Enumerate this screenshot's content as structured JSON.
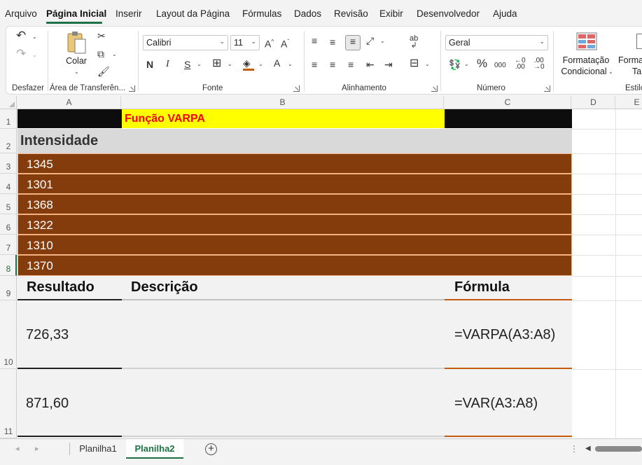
{
  "menu": {
    "items": [
      "Arquivo",
      "Página Inicial",
      "Inserir",
      "Layout da Página",
      "Fórmulas",
      "Dados",
      "Revisão",
      "Exibir",
      "Desenvolvedor",
      "Ajuda"
    ],
    "active": "Página Inicial"
  },
  "ribbon": {
    "groups": {
      "undo": "Desfazer",
      "clipboard": "Área de Transferên...",
      "font": "Fonte",
      "alignment": "Alinhamento",
      "number": "Número",
      "styles": "Estilo"
    },
    "paste_label": "Colar",
    "font_name": "Calibri",
    "font_size": "11",
    "number_format": "Geral",
    "bold": "N",
    "italic": "I",
    "underline": "S",
    "cond_format_line1": "Formatação",
    "cond_format_line2": "Condicional",
    "format_table_line1": "Forma",
    "format_table_line2": "Tab"
  },
  "columns": [
    "A",
    "B",
    "C",
    "D",
    "E"
  ],
  "rows": [
    "1",
    "2",
    "3",
    "4",
    "5",
    "6",
    "7",
    "8",
    "9",
    "10",
    "11"
  ],
  "sheet": {
    "title": "Função VARPA",
    "header": "Intensidade",
    "values": [
      "1345",
      "1301",
      "1368",
      "1322",
      "1310",
      "1370"
    ],
    "result_header": "Resultado",
    "desc_header": "Descrição",
    "formula_header": "Fórmula",
    "results": [
      {
        "value": "726,33",
        "description": "",
        "formula": "=VARPA(A3:A8)"
      },
      {
        "value": "871,60",
        "description": "",
        "formula": "=VAR(A3:A8)"
      }
    ]
  },
  "tabs": {
    "sheets": [
      "Planilha1",
      "Planilha2"
    ],
    "active": "Planilha2"
  },
  "colors": {
    "title_bg": "#ffff00",
    "title_text": "#ff0000",
    "data_bg": "#843c0c",
    "data_border": "#f4b183",
    "header_bg": "#d9d9d9",
    "accent": "#1e7145",
    "formula_underline": "#c55a11"
  }
}
